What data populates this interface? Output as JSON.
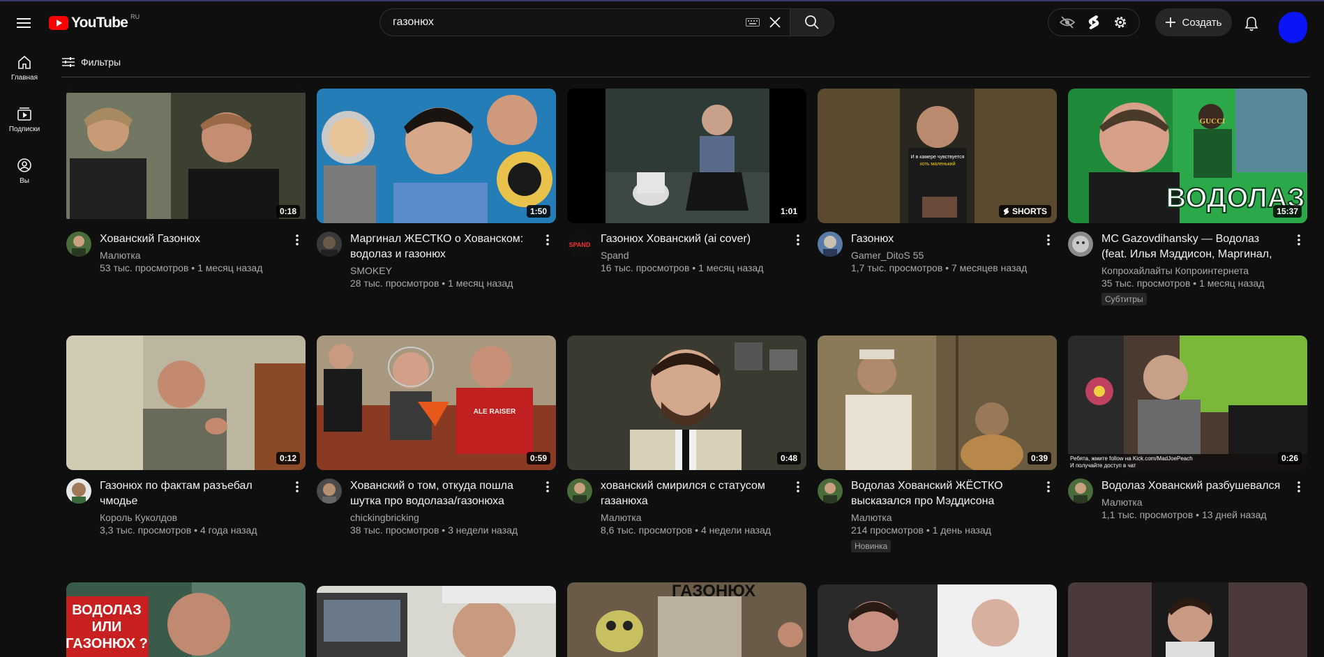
{
  "header": {
    "logo_text": "YouTube",
    "logo_country": "RU",
    "search_value": "газонюх",
    "create_label": "Создать"
  },
  "sidebar": {
    "items": [
      {
        "label": "Главная",
        "icon": "home-icon"
      },
      {
        "label": "Подписки",
        "icon": "subscriptions-icon"
      },
      {
        "label": "Вы",
        "icon": "you-icon"
      }
    ]
  },
  "filters": {
    "label": "Фильтры"
  },
  "colors": {
    "brand": "#ff0000",
    "bg": "#0f0f0f",
    "text": "#f1f1f1",
    "secondary": "#aaaaaa"
  },
  "videos": [
    {
      "title": "Хованский Газонюх",
      "channel": "Малютка",
      "stats": "53 тыс. просмотров • 1 месяц назад",
      "duration": "0:18",
      "tag": ""
    },
    {
      "title": "Маргинал ЖЕСТКО о Хованском: водолаз и газонюх",
      "channel": "SMOKEY",
      "stats": "28 тыс. просмотров • 1 месяц назад",
      "duration": "1:50",
      "tag": ""
    },
    {
      "title": "Газонюх Хованский (ai cover)",
      "channel": "Spand",
      "stats": "16 тыс. просмотров • 1 месяц назад",
      "duration": "1:01",
      "tag": ""
    },
    {
      "title": "Газонюх",
      "channel": "Gamer_DitoS 55",
      "stats": "1,7 тыс. просмотров • 7 месяцев назад",
      "duration": "SHORTS",
      "tag": ""
    },
    {
      "title": "MC Gazovdihansky — Водолаз (feat. Илья Мэддисон, Маргинал, Жмил…",
      "channel": "Копрохайлайты Копроинтернета",
      "stats": "35 тыс. просмотров • 1 месяц назад",
      "duration": "15:37",
      "tag": "Субтитры"
    },
    {
      "title": "Газонюх по фактам разъебал чмодье",
      "channel": "Король Куколдов",
      "stats": "3,3 тыс. просмотров • 4 года назад",
      "duration": "0:12",
      "tag": ""
    },
    {
      "title": "Хованский о том, откуда пошла шутка про водолаза/газонюха",
      "channel": "chickingbricking",
      "stats": "38 тыс. просмотров • 3 недели назад",
      "duration": "0:59",
      "tag": ""
    },
    {
      "title": "хованский смирился с статусом газанюха",
      "channel": "Малютка",
      "stats": "8,6 тыс. просмотров • 4 недели назад",
      "duration": "0:48",
      "tag": ""
    },
    {
      "title": "Водолаз Хованский ЖЁСТКО высказался про Мэддисона",
      "channel": "Малютка",
      "stats": "214 просмотров • 1 день назад",
      "duration": "0:39",
      "tag": "Новинка"
    },
    {
      "title": "Водолаз Хованский разбушевался",
      "channel": "Малютка",
      "stats": "1,1 тыс. просмотров • 13 дней назад",
      "duration": "0:26",
      "tag": ""
    }
  ],
  "thumb_text": {
    "t4_caption_1": "И в камере чувствуется",
    "t4_caption_2": "хоть маленький",
    "t5_word": "ВОДОЛАЗ",
    "t5_brand": "GUCCI",
    "t7_shirt": "ALE RAISER",
    "t10_ticker_1": "Ребята, жмите follow на Kick.com/MadJoePeach",
    "t10_ticker_2": "И получайте доступ в чат",
    "t11_line_1": "ВОДОЛАЗ",
    "t11_line_2": "ИЛИ",
    "t11_line_3": "ГАЗОНЮХ ?",
    "t13_top": "ГАЗОНЮХ"
  }
}
